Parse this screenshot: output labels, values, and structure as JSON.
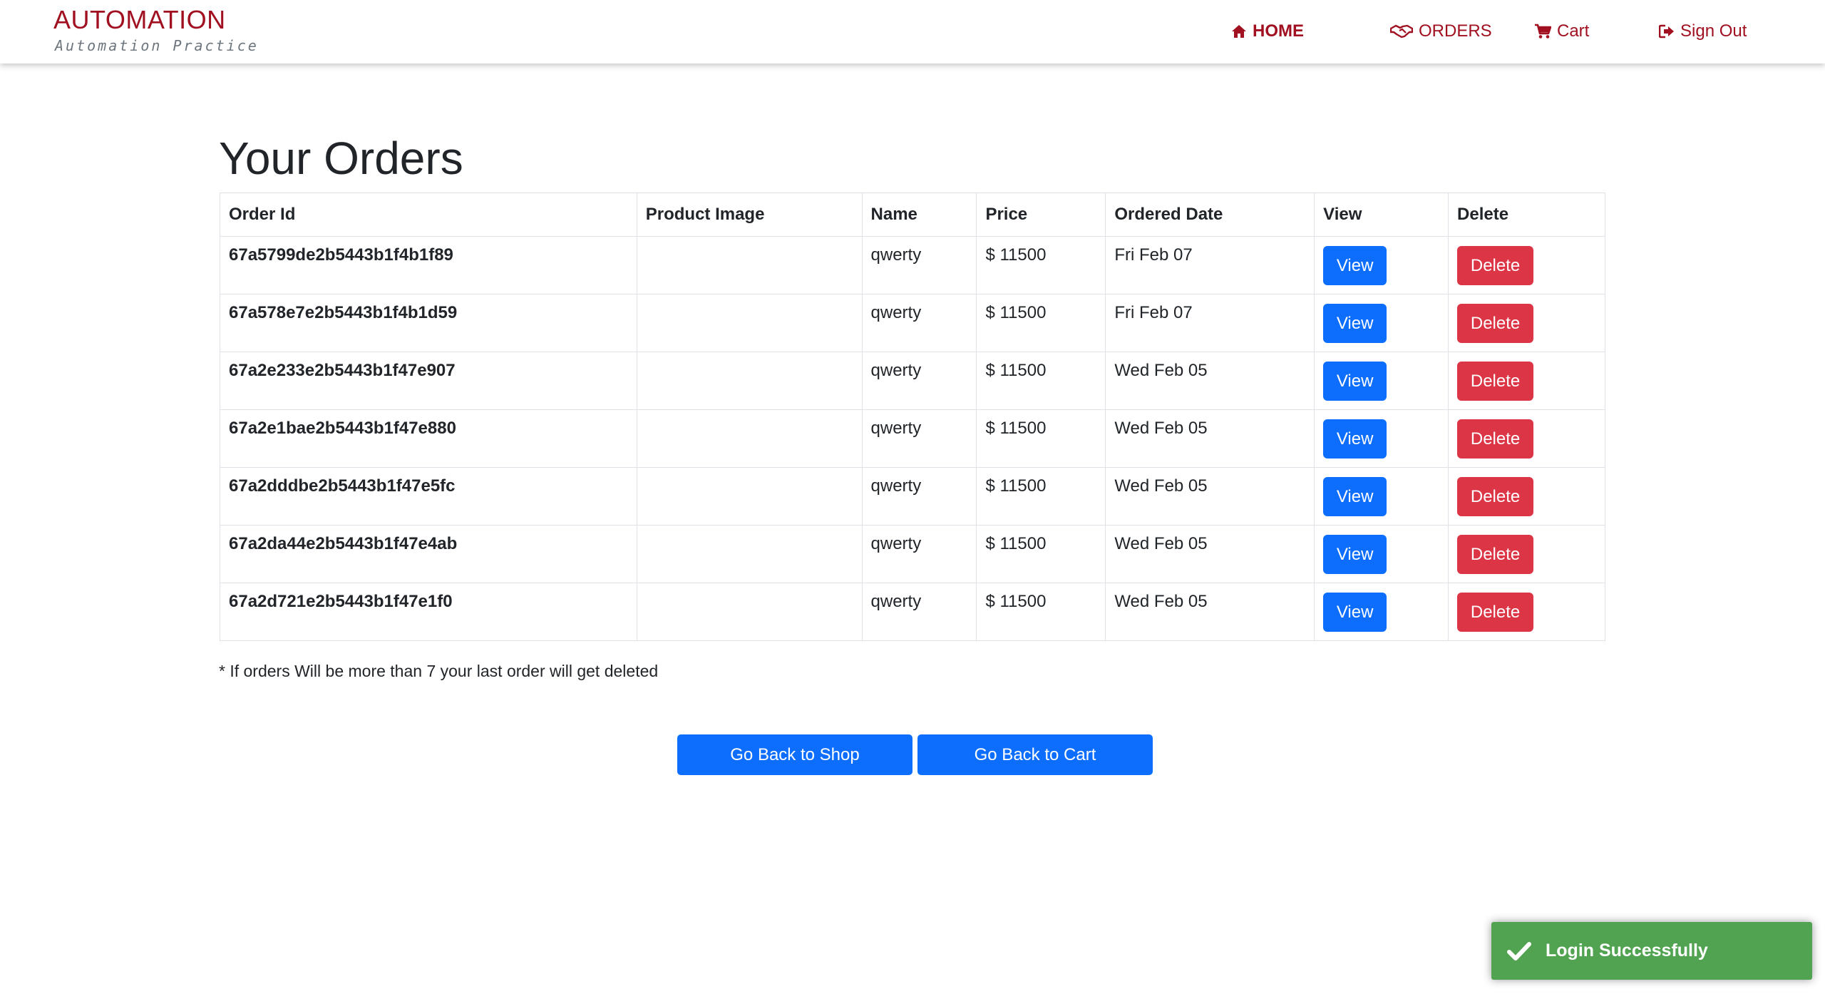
{
  "brand": {
    "title": "AUTOMATION",
    "subtitle": "Automation Practice",
    "color": "#a01020"
  },
  "nav": {
    "home": {
      "label": "HOME",
      "icon": "home-icon"
    },
    "orders": {
      "label": "ORDERS",
      "icon": "handshake-icon"
    },
    "cart": {
      "label": "Cart",
      "icon": "cart-icon"
    },
    "signout": {
      "label": "Sign Out",
      "icon": "sign-out-icon"
    }
  },
  "main": {
    "title": "Your Orders",
    "columns": [
      "Order Id",
      "Product Image",
      "Name",
      "Price",
      "Ordered Date",
      "View",
      "Delete"
    ],
    "orders": [
      {
        "id": "67a5799de2b5443b1f4b1f89",
        "name": "qwerty",
        "price": "$ 11500",
        "date": "Fri Feb 07",
        "view": "View",
        "delete": "Delete"
      },
      {
        "id": "67a578e7e2b5443b1f4b1d59",
        "name": "qwerty",
        "price": "$ 11500",
        "date": "Fri Feb 07",
        "view": "View",
        "delete": "Delete"
      },
      {
        "id": "67a2e233e2b5443b1f47e907",
        "name": "qwerty",
        "price": "$ 11500",
        "date": "Wed Feb 05",
        "view": "View",
        "delete": "Delete"
      },
      {
        "id": "67a2e1bae2b5443b1f47e880",
        "name": "qwerty",
        "price": "$ 11500",
        "date": "Wed Feb 05",
        "view": "View",
        "delete": "Delete"
      },
      {
        "id": "67a2dddbe2b5443b1f47e5fc",
        "name": "qwerty",
        "price": "$ 11500",
        "date": "Wed Feb 05",
        "view": "View",
        "delete": "Delete"
      },
      {
        "id": "67a2da44e2b5443b1f47e4ab",
        "name": "qwerty",
        "price": "$ 11500",
        "date": "Wed Feb 05",
        "view": "View",
        "delete": "Delete"
      },
      {
        "id": "67a2d721e2b5443b1f47e1f0",
        "name": "qwerty",
        "price": "$ 11500",
        "date": "Wed Feb 05",
        "view": "View",
        "delete": "Delete"
      }
    ],
    "note": "* If orders Will be more than 7 your last order will get deleted",
    "back_to_shop": "Go Back to Shop",
    "back_to_cart": "Go Back to Cart"
  },
  "toast": {
    "message": "Login Successfully",
    "icon": "checkmark-icon",
    "color": "#51a351"
  },
  "colors": {
    "primary": "#0d6efd",
    "danger": "#dc3545"
  }
}
